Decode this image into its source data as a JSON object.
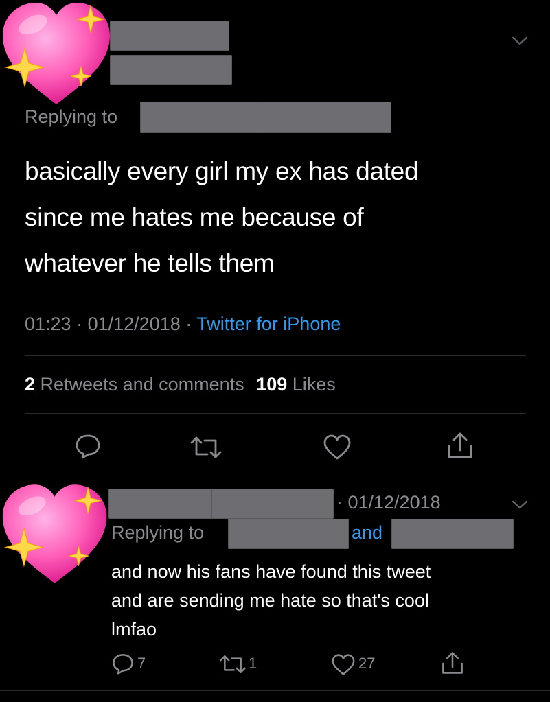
{
  "main_tweet": {
    "replying_label": "Replying to",
    "text_lines": [
      "basically every girl my ex has dated",
      "since me hates me because of",
      "whatever he tells them"
    ],
    "time": "01:23",
    "separator": "·",
    "date": "01/12/2018",
    "source": "Twitter for iPhone",
    "retweets_count": "2",
    "retweets_label": "Retweets and comments",
    "likes_count": "109",
    "likes_label": "Likes"
  },
  "reply_tweet": {
    "date": "· 01/12/2018",
    "replying_label": "Replying to",
    "and_label": "and",
    "text_lines": [
      "and now his fans have found this tweet",
      "and are sending me hate so that's cool",
      "lmfao"
    ],
    "reply_count": "7",
    "retweet_count": "1",
    "like_count": "27"
  },
  "colors": {
    "background": "#000000",
    "text": "#ffffff",
    "muted": "#8b8b8f",
    "link": "#2f9bef",
    "heart": "#ff5fb8"
  },
  "icons": [
    "sparkling-heart-icon",
    "chevron-down-icon",
    "reply-icon",
    "retweet-icon",
    "like-icon",
    "share-icon"
  ]
}
